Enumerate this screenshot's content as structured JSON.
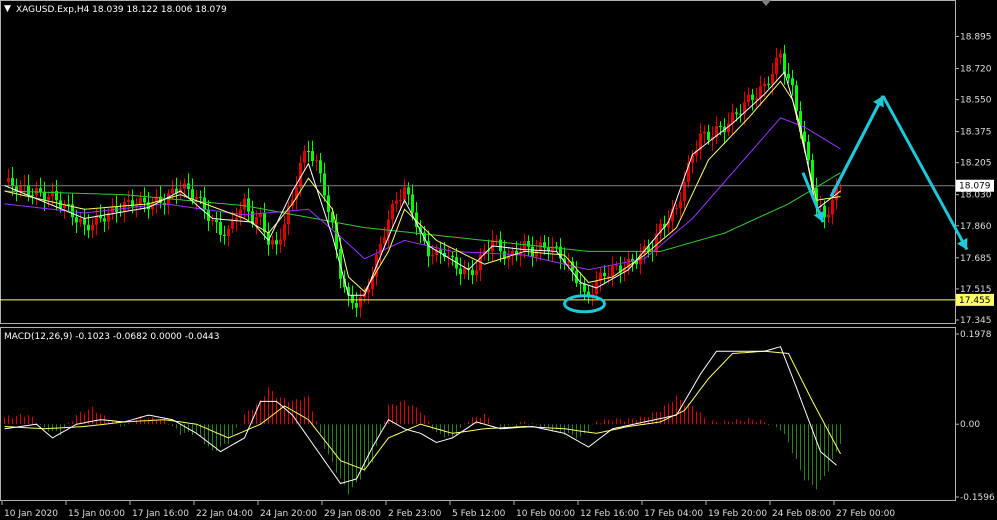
{
  "chart_header": {
    "symbol_line": "XAGUSD.Exp,H4  18.039 18.122 18.006 18.079",
    "macd_line": "MACD(12,26,9) -0.1023 -0.0682 0.0000 -0.0443"
  },
  "colors": {
    "background": "#000000",
    "frame": "#b0b0b0",
    "bull": "#e00000",
    "bear": "#00ff00",
    "ma_fast": "#ffffff",
    "ma_mid": "#ffff66",
    "ma_slow": "#9933ff",
    "ma_long": "#33cc33",
    "hline": "#ffff66",
    "annotation": "#1ec8d8",
    "hist_pos": "#e00000",
    "hist_neg": "#2e7d1e"
  },
  "chart_data": [
    {
      "type": "candlestick",
      "symbol": "XAGUSD.Exp",
      "timeframe": "H4",
      "ohlc_current": {
        "open": 18.039,
        "high": 18.122,
        "low": 18.006,
        "close": 18.079
      },
      "ylim": [
        17.345,
        18.985
      ],
      "price_axis_ticks": [
        "18.895",
        "18.720",
        "18.550",
        "18.375",
        "18.205",
        "18.030",
        "17.860",
        "17.685",
        "17.515",
        "17.345"
      ],
      "current_price_label": "18.079",
      "horizontal_line_label": "17.455",
      "horizontal_line_value": 17.455,
      "time_labels": [
        "10 Jan 2020",
        "15 Jan 00:00",
        "17 Jan 16:00",
        "22 Jan 04:00",
        "24 Jan 20:00",
        "29 Jan 08:00",
        "2 Feb 23:00",
        "5 Feb 12:00",
        "10 Feb 00:00",
        "12 Feb 16:00",
        "17 Feb 04:00",
        "19 Feb 20:00",
        "24 Feb 08:00",
        "27 Feb 00:00"
      ],
      "price_path": [
        [
          0,
          18.1
        ],
        [
          6,
          18.05
        ],
        [
          12,
          18.02
        ],
        [
          16,
          17.95
        ],
        [
          20,
          17.85
        ],
        [
          24,
          17.9
        ],
        [
          28,
          17.95
        ],
        [
          32,
          17.99
        ],
        [
          36,
          17.98
        ],
        [
          40,
          18.0
        ],
        [
          44,
          18.08
        ],
        [
          48,
          18.02
        ],
        [
          52,
          17.88
        ],
        [
          54,
          17.83
        ],
        [
          56,
          17.82
        ],
        [
          58,
          17.93
        ],
        [
          60,
          17.98
        ],
        [
          62,
          17.9
        ],
        [
          64,
          17.9
        ],
        [
          66,
          17.78
        ],
        [
          68,
          17.74
        ],
        [
          70,
          17.88
        ],
        [
          72,
          18.0
        ],
        [
          74,
          18.2
        ],
        [
          76,
          18.28
        ],
        [
          78,
          18.2
        ],
        [
          80,
          18.05
        ],
        [
          82,
          17.85
        ],
        [
          84,
          17.6
        ],
        [
          86,
          17.45
        ],
        [
          88,
          17.44
        ],
        [
          90,
          17.47
        ],
        [
          92,
          17.6
        ],
        [
          94,
          17.75
        ],
        [
          96,
          17.9
        ],
        [
          98,
          18.0
        ],
        [
          100,
          18.06
        ],
        [
          102,
          17.95
        ],
        [
          104,
          17.8
        ],
        [
          106,
          17.72
        ],
        [
          108,
          17.7
        ],
        [
          110,
          17.72
        ],
        [
          112,
          17.66
        ],
        [
          114,
          17.62
        ],
        [
          116,
          17.6
        ],
        [
          118,
          17.63
        ],
        [
          120,
          17.72
        ],
        [
          122,
          17.78
        ],
        [
          124,
          17.73
        ],
        [
          126,
          17.68
        ],
        [
          128,
          17.72
        ],
        [
          130,
          17.75
        ],
        [
          132,
          17.72
        ],
        [
          134,
          17.74
        ],
        [
          136,
          17.75
        ],
        [
          138,
          17.72
        ],
        [
          140,
          17.68
        ],
        [
          142,
          17.6
        ],
        [
          144,
          17.55
        ],
        [
          145,
          17.47
        ],
        [
          146,
          17.48
        ],
        [
          148,
          17.55
        ],
        [
          150,
          17.6
        ],
        [
          152,
          17.62
        ],
        [
          154,
          17.63
        ],
        [
          156,
          17.65
        ],
        [
          158,
          17.68
        ],
        [
          160,
          17.72
        ],
        [
          162,
          17.75
        ],
        [
          164,
          17.85
        ],
        [
          166,
          17.9
        ],
        [
          168,
          17.95
        ],
        [
          170,
          18.1
        ],
        [
          172,
          18.25
        ],
        [
          174,
          18.35
        ],
        [
          176,
          18.35
        ],
        [
          178,
          18.38
        ],
        [
          180,
          18.4
        ],
        [
          182,
          18.45
        ],
        [
          184,
          18.5
        ],
        [
          186,
          18.55
        ],
        [
          188,
          18.58
        ],
        [
          190,
          18.62
        ],
        [
          192,
          18.7
        ],
        [
          194,
          18.8
        ],
        [
          195,
          18.72
        ],
        [
          197,
          18.6
        ],
        [
          199,
          18.4
        ],
        [
          201,
          18.2
        ],
        [
          203,
          17.98
        ],
        [
          205,
          17.9
        ],
        [
          207,
          18.0
        ],
        [
          209,
          18.08
        ]
      ],
      "ma_fast": [
        [
          0,
          18.08
        ],
        [
          20,
          17.9
        ],
        [
          36,
          17.96
        ],
        [
          44,
          18.05
        ],
        [
          52,
          17.9
        ],
        [
          62,
          17.88
        ],
        [
          66,
          17.78
        ],
        [
          72,
          18.05
        ],
        [
          76,
          18.2
        ],
        [
          82,
          17.8
        ],
        [
          86,
          17.48
        ],
        [
          90,
          17.48
        ],
        [
          96,
          17.8
        ],
        [
          100,
          18.0
        ],
        [
          106,
          17.75
        ],
        [
          116,
          17.62
        ],
        [
          122,
          17.75
        ],
        [
          130,
          17.73
        ],
        [
          138,
          17.72
        ],
        [
          144,
          17.55
        ],
        [
          148,
          17.52
        ],
        [
          156,
          17.62
        ],
        [
          166,
          17.88
        ],
        [
          172,
          18.25
        ],
        [
          182,
          18.42
        ],
        [
          190,
          18.58
        ],
        [
          195,
          18.7
        ],
        [
          199,
          18.4
        ],
        [
          203,
          17.95
        ],
        [
          209,
          18.05
        ]
      ],
      "ma_mid": [
        [
          0,
          18.05
        ],
        [
          20,
          17.95
        ],
        [
          36,
          17.98
        ],
        [
          44,
          18.03
        ],
        [
          60,
          17.9
        ],
        [
          66,
          17.82
        ],
        [
          72,
          17.98
        ],
        [
          76,
          18.12
        ],
        [
          82,
          17.95
        ],
        [
          86,
          17.58
        ],
        [
          90,
          17.5
        ],
        [
          96,
          17.72
        ],
        [
          100,
          17.95
        ],
        [
          108,
          17.78
        ],
        [
          120,
          17.65
        ],
        [
          130,
          17.72
        ],
        [
          140,
          17.7
        ],
        [
          146,
          17.55
        ],
        [
          152,
          17.58
        ],
        [
          160,
          17.7
        ],
        [
          168,
          17.85
        ],
        [
          176,
          18.22
        ],
        [
          186,
          18.45
        ],
        [
          194,
          18.65
        ],
        [
          197,
          18.55
        ],
        [
          203,
          18.0
        ],
        [
          209,
          18.02
        ]
      ],
      "ma_slow": [
        [
          0,
          17.98
        ],
        [
          20,
          17.93
        ],
        [
          40,
          17.98
        ],
        [
          60,
          17.92
        ],
        [
          76,
          17.95
        ],
        [
          84,
          17.8
        ],
        [
          90,
          17.68
        ],
        [
          100,
          17.78
        ],
        [
          112,
          17.72
        ],
        [
          130,
          17.7
        ],
        [
          146,
          17.62
        ],
        [
          160,
          17.68
        ],
        [
          172,
          17.9
        ],
        [
          184,
          18.2
        ],
        [
          194,
          18.45
        ],
        [
          200,
          18.4
        ],
        [
          209,
          18.28
        ]
      ],
      "ma_long": [
        [
          0,
          18.05
        ],
        [
          30,
          18.03
        ],
        [
          60,
          17.97
        ],
        [
          90,
          17.85
        ],
        [
          120,
          17.78
        ],
        [
          146,
          17.72
        ],
        [
          164,
          17.72
        ],
        [
          180,
          17.82
        ],
        [
          196,
          17.98
        ],
        [
          209,
          18.15
        ]
      ],
      "annotations": {
        "arrow_down_small": [
          [
            200,
            18.15
          ],
          [
            205,
            17.88
          ]
        ],
        "arrow_up": [
          [
            207,
            18.02
          ],
          [
            220,
            18.57
          ]
        ],
        "arrow_down": [
          [
            220,
            18.57
          ],
          [
            241,
            17.73
          ]
        ],
        "ellipse_at": [
          145,
          17.45
        ]
      }
    },
    {
      "type": "bar",
      "title": "MACD(12,26,9)",
      "ylim": [
        -0.1596,
        0.1978
      ],
      "axis_ticks": [
        "0.1978",
        "0.00",
        "-0.1596"
      ],
      "histogram_path": [
        [
          0,
          0.015
        ],
        [
          6,
          0.02
        ],
        [
          10,
          -0.01
        ],
        [
          14,
          -0.02
        ],
        [
          18,
          0.02
        ],
        [
          22,
          0.035
        ],
        [
          26,
          0.01
        ],
        [
          30,
          -0.005
        ],
        [
          34,
          0.015
        ],
        [
          40,
          0.01
        ],
        [
          44,
          -0.02
        ],
        [
          48,
          -0.02
        ],
        [
          52,
          -0.06
        ],
        [
          56,
          -0.04
        ],
        [
          60,
          0.02
        ],
        [
          64,
          0.05
        ],
        [
          66,
          0.08
        ],
        [
          68,
          0.06
        ],
        [
          72,
          0.05
        ],
        [
          76,
          0.06
        ],
        [
          80,
          -0.05
        ],
        [
          84,
          -0.12
        ],
        [
          86,
          -0.15
        ],
        [
          88,
          -0.13
        ],
        [
          92,
          -0.08
        ],
        [
          94,
          -0.02
        ],
        [
          96,
          0.04
        ],
        [
          100,
          0.05
        ],
        [
          104,
          0.03
        ],
        [
          108,
          -0.02
        ],
        [
          112,
          -0.03
        ],
        [
          116,
          0.01
        ],
        [
          120,
          0.02
        ],
        [
          124,
          -0.01
        ],
        [
          130,
          0.005
        ],
        [
          136,
          -0.01
        ],
        [
          140,
          -0.02
        ],
        [
          144,
          -0.03
        ],
        [
          148,
          0.005
        ],
        [
          152,
          0.01
        ],
        [
          156,
          0.01
        ],
        [
          160,
          0.015
        ],
        [
          164,
          0.03
        ],
        [
          168,
          0.06
        ],
        [
          170,
          0.045
        ],
        [
          172,
          0.04
        ],
        [
          176,
          0.005
        ],
        [
          180,
          0.005
        ],
        [
          186,
          0.01
        ],
        [
          190,
          0.005
        ],
        [
          194,
          -0.01
        ],
        [
          196,
          -0.04
        ],
        [
          198,
          -0.08
        ],
        [
          200,
          -0.12
        ],
        [
          203,
          -0.14
        ],
        [
          206,
          -0.1
        ],
        [
          209,
          -0.04
        ]
      ],
      "macd_line": [
        [
          0,
          -0.01
        ],
        [
          8,
          0.0
        ],
        [
          12,
          -0.03
        ],
        [
          18,
          0.0
        ],
        [
          24,
          0.01
        ],
        [
          30,
          0.005
        ],
        [
          36,
          0.02
        ],
        [
          42,
          0.01
        ],
        [
          48,
          -0.02
        ],
        [
          54,
          -0.06
        ],
        [
          60,
          -0.03
        ],
        [
          64,
          0.05
        ],
        [
          68,
          0.05
        ],
        [
          72,
          0.02
        ],
        [
          76,
          -0.03
        ],
        [
          80,
          -0.08
        ],
        [
          84,
          -0.13
        ],
        [
          88,
          -0.12
        ],
        [
          92,
          -0.05
        ],
        [
          96,
          0.01
        ],
        [
          100,
          -0.01
        ],
        [
          104,
          -0.02
        ],
        [
          108,
          -0.04
        ],
        [
          112,
          -0.03
        ],
        [
          118,
          0.005
        ],
        [
          124,
          -0.01
        ],
        [
          132,
          -0.005
        ],
        [
          140,
          -0.02
        ],
        [
          146,
          -0.05
        ],
        [
          152,
          -0.01
        ],
        [
          160,
          0.005
        ],
        [
          168,
          0.02
        ],
        [
          174,
          0.11
        ],
        [
          178,
          0.16
        ],
        [
          184,
          0.16
        ],
        [
          190,
          0.16
        ],
        [
          194,
          0.17
        ],
        [
          198,
          0.08
        ],
        [
          204,
          -0.06
        ],
        [
          208,
          -0.09
        ]
      ],
      "signal_line": [
        [
          0,
          -0.005
        ],
        [
          10,
          -0.01
        ],
        [
          20,
          -0.005
        ],
        [
          30,
          0.005
        ],
        [
          40,
          0.01
        ],
        [
          48,
          0.0
        ],
        [
          56,
          -0.03
        ],
        [
          64,
          0.0
        ],
        [
          70,
          0.04
        ],
        [
          76,
          0.01
        ],
        [
          84,
          -0.08
        ],
        [
          90,
          -0.1
        ],
        [
          96,
          -0.03
        ],
        [
          104,
          0.0
        ],
        [
          112,
          -0.02
        ],
        [
          120,
          -0.01
        ],
        [
          130,
          -0.005
        ],
        [
          140,
          -0.01
        ],
        [
          148,
          -0.02
        ],
        [
          156,
          -0.005
        ],
        [
          164,
          0.005
        ],
        [
          170,
          0.03
        ],
        [
          176,
          0.1
        ],
        [
          182,
          0.155
        ],
        [
          190,
          0.16
        ],
        [
          196,
          0.155
        ],
        [
          202,
          0.05
        ],
        [
          209,
          -0.065
        ]
      ]
    }
  ]
}
